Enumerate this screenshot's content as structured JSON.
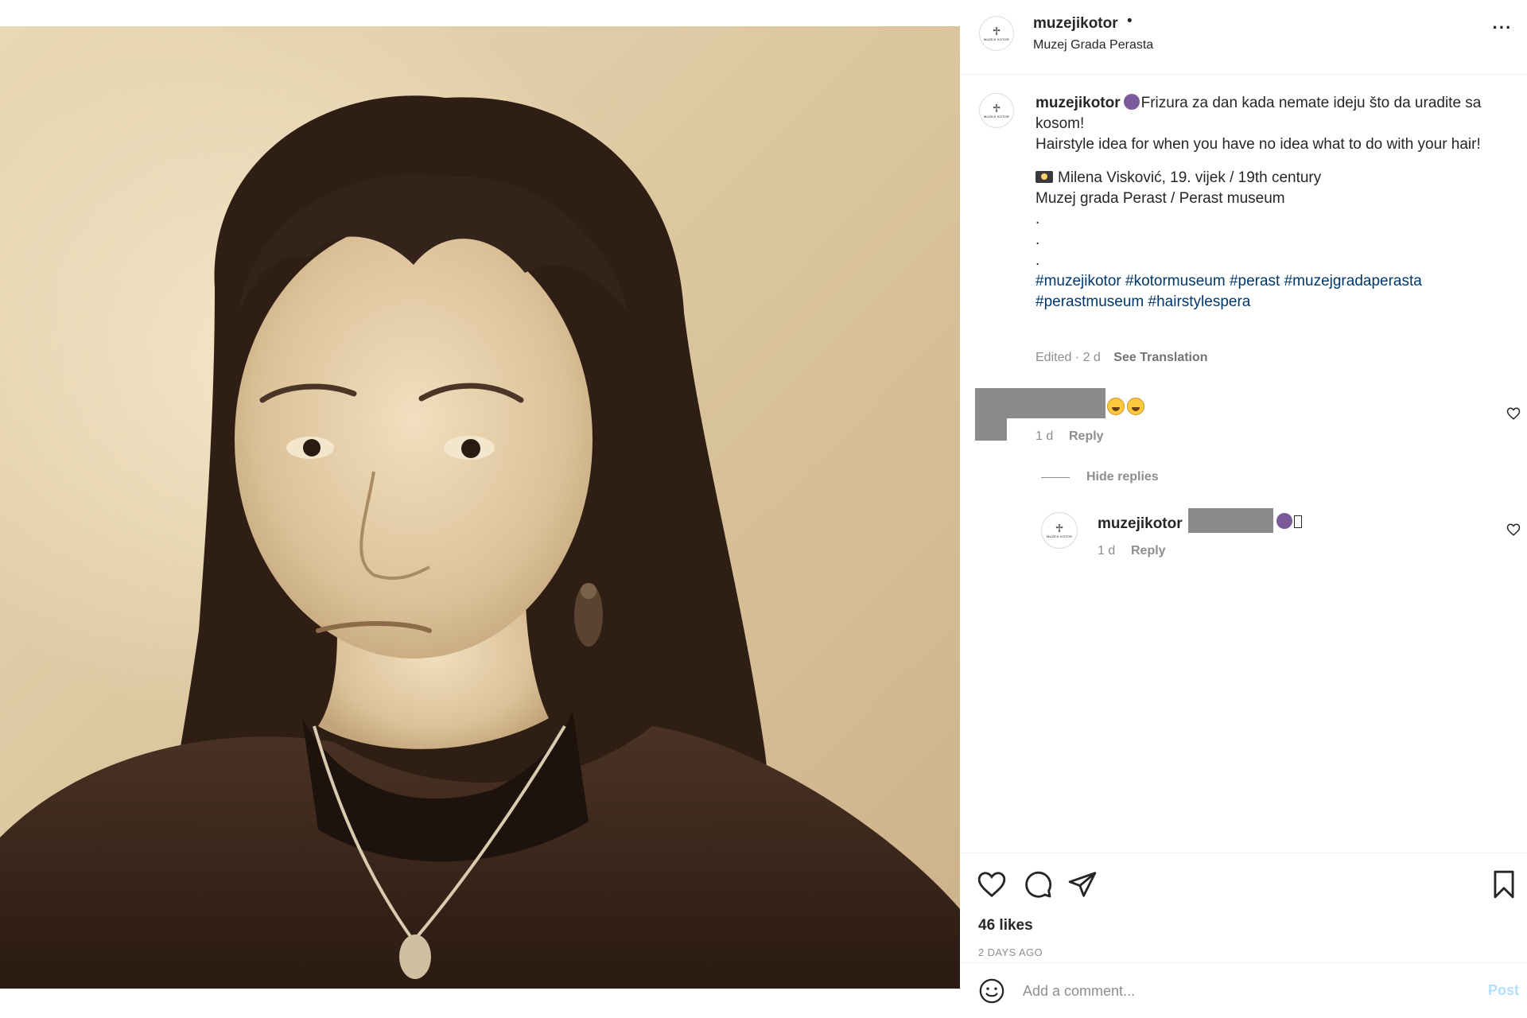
{
  "post": {
    "image_alt": "Sepia portrait photograph of a woman with curled hair, earrings and a necklace",
    "header": {
      "username": "muzejikotor",
      "dot": "•",
      "location": "Muzej Grada Perasta",
      "more_label": "···"
    },
    "avatar": {
      "glyph": "♱",
      "tiny_text": "MUZEJI KOTOR"
    },
    "caption": {
      "username": "muzejikotor",
      "line1": "Frizura za dan kada nemate ideju što da uradite sa kosom!",
      "line2": "Hairstyle idea for when you have no idea what to do with your hair!",
      "line3": "Milena Visković, 19. vijek / 19th century",
      "line4": "Muzej grada Perast / Perast museum",
      "dots": [
        ".",
        ".",
        "."
      ],
      "hashtags": [
        "#muzejikotor",
        "#kotormuseum",
        "#perast",
        "#muzejgradaperasta",
        "#perastmuseum",
        "#hairstylespera"
      ],
      "meta": "Edited · 2 d",
      "see_translation": "See Translation"
    },
    "comments": [
      {
        "time": "1 d",
        "reply_label": "Reply",
        "hide_replies": "Hide replies",
        "replies": [
          {
            "username": "muzejikotor",
            "time": "1 d",
            "reply_label": "Reply"
          }
        ]
      }
    ],
    "actions": {
      "likes": "46 likes",
      "ago": "2 DAYS AGO"
    },
    "add_comment": {
      "placeholder": "Add a comment...",
      "post_label": "Post"
    },
    "colors": {
      "link": "#00376b",
      "muted": "#8e8e8e",
      "text": "#262626",
      "post_button": "#b2dffc"
    }
  }
}
